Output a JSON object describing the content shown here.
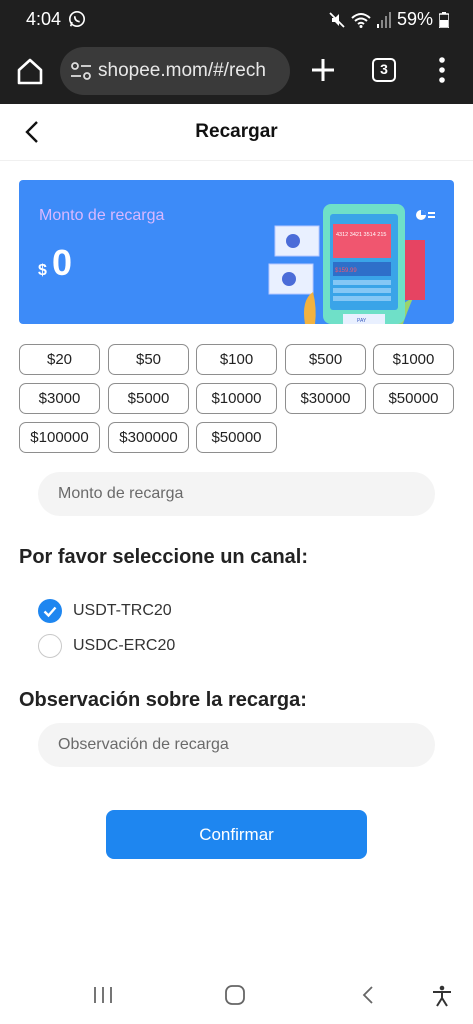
{
  "status_bar": {
    "time": "4:04",
    "battery": "59%"
  },
  "browser": {
    "url": "shopee.mom/#/rech",
    "tab_count": "3"
  },
  "header": {
    "title": "Recargar"
  },
  "balance_card": {
    "label": "Monto de recarga",
    "currency": "$",
    "amount": "0",
    "card_numbers": "4312 3421 3514 215",
    "card_amount": "$159.99",
    "pay_label": "PAY"
  },
  "amount_options": [
    "$20",
    "$50",
    "$100",
    "$500",
    "$1000",
    "$3000",
    "$5000",
    "$10000",
    "$30000",
    "$50000",
    "$100000",
    "$300000",
    "$50000"
  ],
  "amount_input": {
    "placeholder": "Monto de recarga"
  },
  "channel": {
    "heading": "Por favor seleccione un canal:",
    "options": [
      {
        "label": "USDT-TRC20",
        "selected": true
      },
      {
        "label": "USDC-ERC20",
        "selected": false
      }
    ]
  },
  "remark": {
    "heading": "Observación sobre la recarga:",
    "placeholder": "Observación de recarga"
  },
  "confirm_button": {
    "label": "Confirmar"
  },
  "colors": {
    "primary": "#1e86f0",
    "card_bg": "#3d8bf8",
    "label_purple": "#d9b8ff"
  }
}
